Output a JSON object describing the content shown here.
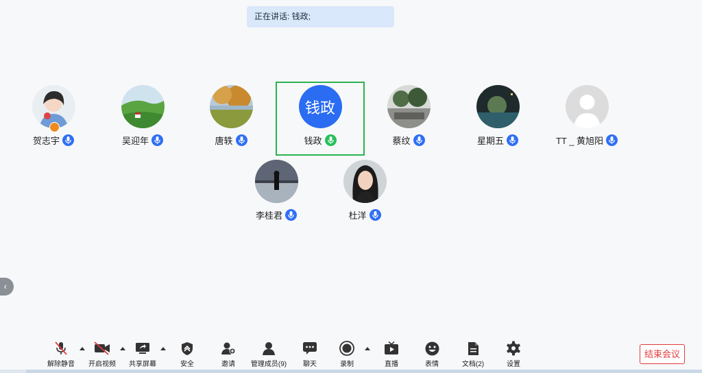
{
  "banner": {
    "text": "正在讲话: 钱政;"
  },
  "participants": [
    {
      "name": "贺志宇",
      "mic": "blue"
    },
    {
      "name": "吴迎年",
      "mic": "blue"
    },
    {
      "name": "唐轶",
      "mic": "blue"
    },
    {
      "name": "钱政",
      "avatar_text": "钱政",
      "mic": "green",
      "speaking": true
    },
    {
      "name": "蔡纹",
      "mic": "blue"
    },
    {
      "name": "星期五",
      "mic": "blue"
    },
    {
      "name": "TT _ 黄旭阳",
      "mic": "blue"
    },
    {
      "name": "李桂君",
      "mic": "blue"
    },
    {
      "name": "杜洋",
      "mic": "blue"
    }
  ],
  "toolbar": {
    "items": [
      {
        "label": "解除静音",
        "icon": "mic-muted-icon"
      },
      {
        "label": "开启视频",
        "icon": "video-off-icon"
      },
      {
        "label": "共享屏幕",
        "icon": "share-screen-icon"
      },
      {
        "label": "安全",
        "icon": "shield-icon"
      },
      {
        "label": "邀请",
        "icon": "invite-user-icon"
      },
      {
        "label": "管理成员(9)",
        "icon": "members-icon"
      },
      {
        "label": "聊天",
        "icon": "chat-icon"
      },
      {
        "label": "录制",
        "icon": "record-icon"
      },
      {
        "label": "直播",
        "icon": "live-icon"
      },
      {
        "label": "表情",
        "icon": "emoji-icon"
      },
      {
        "label": "文档(2)",
        "icon": "document-icon"
      },
      {
        "label": "设置",
        "icon": "gear-icon"
      }
    ],
    "end_meeting": "结束会议"
  },
  "colors": {
    "accent": "#2f6ff5",
    "speaking": "#25c05b",
    "danger": "#e23a3a"
  }
}
